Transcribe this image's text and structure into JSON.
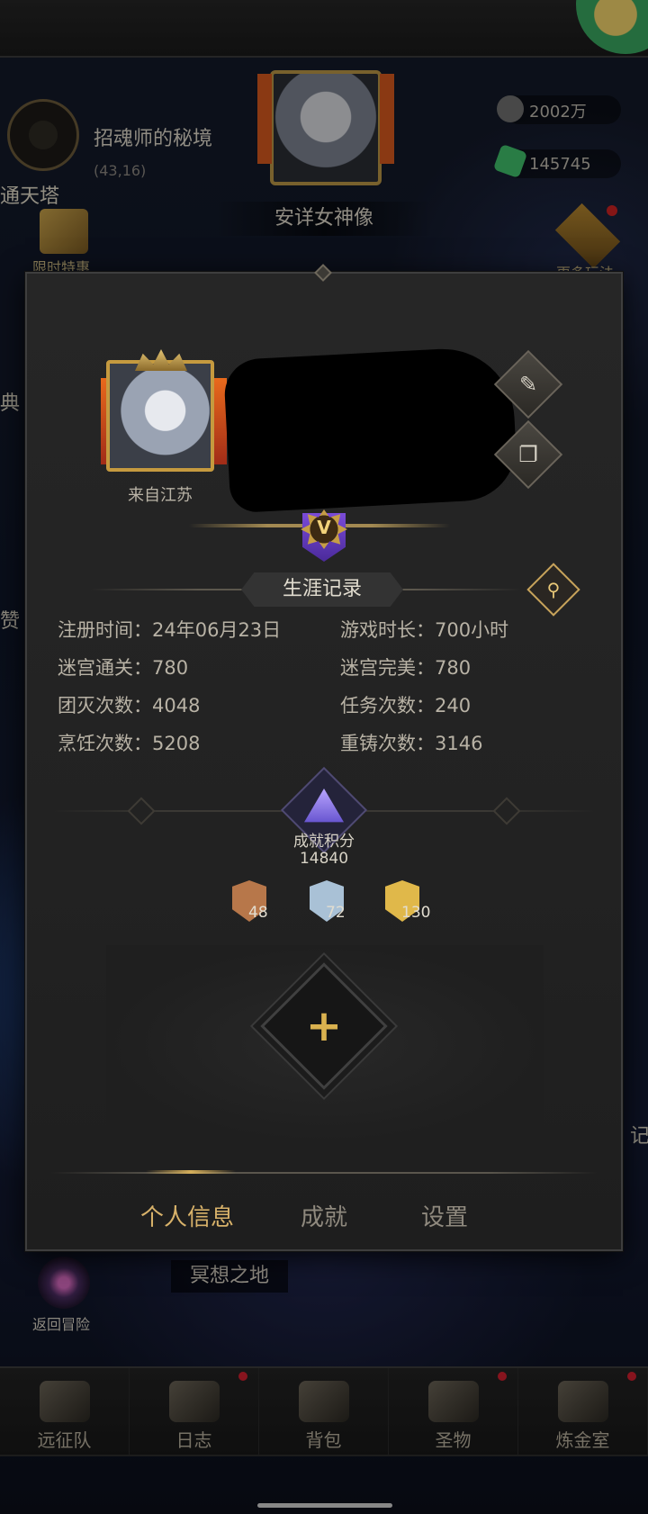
{
  "scene": {
    "map_title": "招魂师的秘境",
    "map_coords": "(43,16)",
    "tower_label": "通天塔",
    "offer_label": "限时特惠",
    "more_label": "更多玩法",
    "statue_label": "安详女神像",
    "resources": [
      {
        "icon": "stone-coin-icon",
        "value": "2002万",
        "color": "#6f6f6f"
      },
      {
        "icon": "green-gem-icon",
        "value": "145745",
        "color": "#3fbf6a"
      }
    ],
    "side_left_1": "典",
    "side_left_2": "赞",
    "side_right": "记",
    "back_label": "返回冒险",
    "meditate_label": "冥想之地"
  },
  "nav": [
    {
      "label": "远征队",
      "icon": "helmet-icon"
    },
    {
      "label": "日志",
      "icon": "scroll-icon"
    },
    {
      "label": "背包",
      "icon": "backpack-icon"
    },
    {
      "label": "圣物",
      "icon": "relic-icon"
    },
    {
      "label": "炼金室",
      "icon": "alchemy-icon"
    }
  ],
  "profile": {
    "origin": "来自江苏",
    "vip_letter": "V",
    "section_title": "生涯记录",
    "edit_glyph": "✎",
    "copy_glyph": "❐",
    "search_glyph": "⚲",
    "stats": [
      {
        "text": "注册时间：24年06月23日"
      },
      {
        "text": "游戏时长：700小时"
      },
      {
        "text": "迷宫通关：780"
      },
      {
        "text": "迷宫完美：780"
      },
      {
        "text": "团灭次数：4048"
      },
      {
        "text": "任务次数：240"
      },
      {
        "text": "烹饪次数：5208"
      },
      {
        "text": "重铸次数：3146"
      }
    ],
    "achievement": {
      "label": "成就积分",
      "score": "14840",
      "medals": [
        {
          "name": "bronze",
          "count": "48",
          "color": "#b7774a"
        },
        {
          "name": "silver",
          "count": "72",
          "color": "#a9c1d6"
        },
        {
          "name": "gold",
          "count": "130",
          "color": "#e0b84a"
        }
      ]
    },
    "slot_plus": "+",
    "tabs": [
      "个人信息",
      "成就",
      "设置"
    ]
  }
}
